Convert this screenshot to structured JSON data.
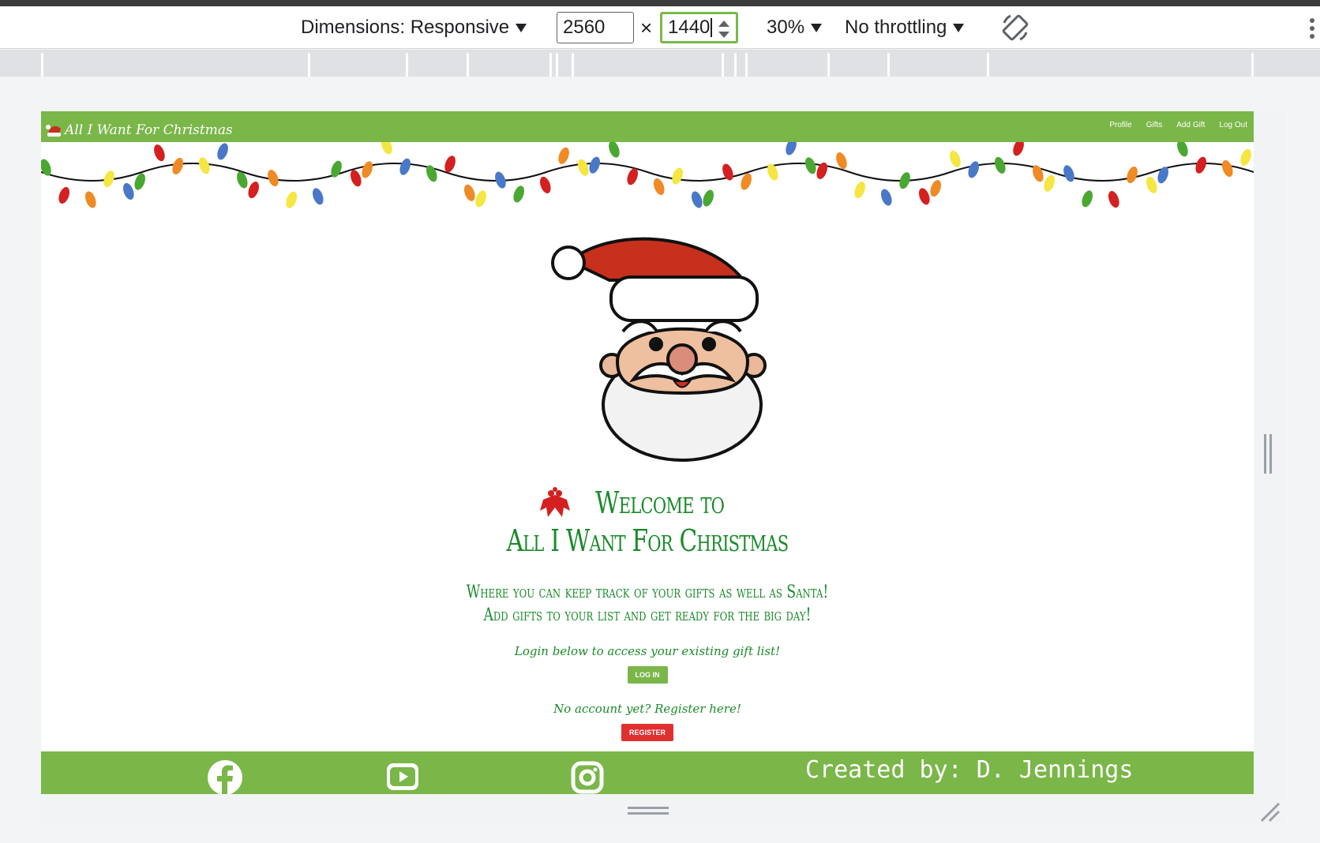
{
  "devtools": {
    "dimensions_label": "Dimensions: Responsive",
    "width_value": "2560",
    "times": "×",
    "height_value": "1440",
    "zoom": "30%",
    "throttling": "No throttling"
  },
  "site": {
    "brand": "All I Want For Christmas",
    "nav": [
      "Profile",
      "Gifts",
      "Add Gift",
      "Log Out"
    ],
    "welcome_line1": "Welcome to",
    "welcome_line2": "All I Want For Christmas",
    "tagline_line1": "Where you can keep track of your gifts as well as Santa!",
    "tagline_line2": "Add gifts to your list and get ready for the big day!",
    "login_prompt": "Login below to access your existing gift list!",
    "login_button": "LOG IN",
    "register_prompt": "No account yet? Register here!",
    "register_button": "REGISTER",
    "credit": "Created by: D. Jennings"
  },
  "colors": {
    "nav_green": "#7ab648",
    "text_green": "#1a8a2a",
    "register_red": "#e03030",
    "santa_red": "#c8301e"
  },
  "icons": [
    "hat-icon",
    "facebook-icon",
    "youtube-icon",
    "instagram-icon",
    "rotate-icon",
    "more-icon"
  ]
}
